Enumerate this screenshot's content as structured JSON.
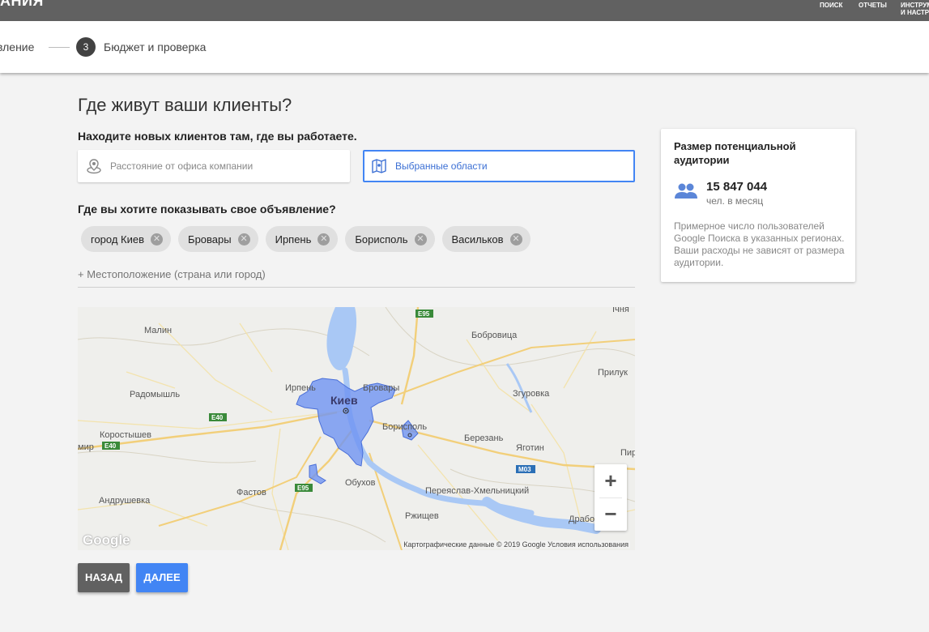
{
  "topbar": {
    "brand": "АНИЯ",
    "nav": [
      {
        "label": "ПОИСК"
      },
      {
        "label": "ОТЧЕТЫ"
      },
      {
        "label": "ИНСТРУМ И НАСТР"
      }
    ]
  },
  "stepper": {
    "prev_label": "вление",
    "step_number": "3",
    "step_label": "Бюджет и проверка"
  },
  "main": {
    "title": "Где живут ваши клиенты?",
    "subtitle": "Находите новых клиентов там, где вы работаете.",
    "options": [
      {
        "label": "Расстояние от офиса компании",
        "icon": "location-radius-icon",
        "selected": false
      },
      {
        "label": "Выбранные области",
        "icon": "map-icon",
        "selected": true
      }
    ],
    "question": "Где вы хотите показывать свое объявление?",
    "locations": [
      {
        "label": "город Киев"
      },
      {
        "label": "Бровары"
      },
      {
        "label": "Ирпень"
      },
      {
        "label": "Борисполь"
      },
      {
        "label": "Васильков"
      }
    ],
    "add_location": "+ Местоположение (страна или город)"
  },
  "map": {
    "labels": {
      "irpen": "Ирпень",
      "kyiv": "Киев",
      "brovary": "Бровары",
      "boryspil": "Борисполь",
      "malyn": "Малин",
      "radomyshl": "Радомышль",
      "korostyshev": "Коростышев",
      "zhytomyr": "мир",
      "fastov": "Фастов",
      "andrushevka": "Андрушевка",
      "obukhov": "Обухов",
      "rzhyshchev": "Ржищев",
      "pereyaslav": "Переяслав-Хмельницкий",
      "berezan": "Березань",
      "yagotyn": "Яготин",
      "zgurovka": "Згуровка",
      "bobrovitsa": "Бобровица",
      "pryluky": "Прилук",
      "ichnia": "Ічня",
      "piryatin": "Пир",
      "drabiv": "Драбо",
      "e95_top": "E95",
      "e95_bottom": "E95",
      "e40_a": "E40",
      "e40_b": "E40",
      "m03": "M03"
    },
    "google_logo": "Google",
    "credits": "Картографические данные © 2019 Google   Условия использования",
    "zoom_in": "+",
    "zoom_out": "−",
    "colors": {
      "region_fill": "#6f93f2",
      "region_stroke": "#4a6fd8",
      "water": "#a9c8f5",
      "road": "#f7d488"
    }
  },
  "buttons": {
    "back": "НАЗАД",
    "next": "ДАЛЕЕ"
  },
  "audience": {
    "title": "Размер потенциальной аудитории",
    "count": "15 847 044",
    "unit": "чел. в месяц",
    "note": "Примерное число пользователей Google Поиска в указанных регионах. Ваши расходы не зависят от размера аудитории.",
    "icon": "people-icon"
  },
  "colors": {
    "accent": "#4285f4",
    "dark_button": "#616161",
    "topbar": "#616161"
  }
}
